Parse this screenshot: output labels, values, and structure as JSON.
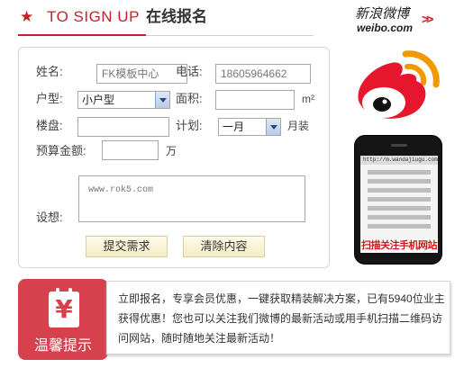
{
  "header": {
    "star": "★",
    "title_en": "TO SIGN UP",
    "title_cn": "在线报名",
    "weibo_cn": "新浪微博",
    "weibo_en": "weibo.com",
    "arrow": ">>"
  },
  "form": {
    "name_label": "姓名:",
    "name_value": "FK模板中心",
    "phone_label": "电话:",
    "phone_value": "18605964662",
    "house_type_label": "户型:",
    "house_type_value": "小户型",
    "area_label": "面积:",
    "area_value": "",
    "area_unit": "m²",
    "estate_label": "楼盘:",
    "estate_value": "",
    "plan_label": "计划:",
    "plan_value": "一月",
    "plan_unit": "月装",
    "budget_label": "预算金额:",
    "budget_value": "",
    "budget_unit": "万",
    "idea_label": "设想:",
    "idea_value": "www.rok5.com",
    "submit_label": "提交需求",
    "clear_label": "清除内容"
  },
  "phone": {
    "url": "http://m.wandajiugu.com/",
    "caption": "扫描关注手机网站"
  },
  "notice": {
    "icon": "¥",
    "title": "温馨提示",
    "text": "立即报名，专享会员优惠，一键获取精装解决方案，已有5940位业主获得优惠！您也可以关注我们微博的最新活动或用手机扫描二维码访问网站，随时随地关注最新活动！"
  },
  "colors": {
    "accent": "#c8202b",
    "notice_red": "#d7404d",
    "weibo_red": "#e6162d",
    "weibo_orange": "#f39800"
  },
  "icons": [
    "star-icon",
    "weibo-logo",
    "weibo-bird-icon",
    "dropdown-arrow-icon",
    "yen-icon",
    "phone-icon"
  ]
}
